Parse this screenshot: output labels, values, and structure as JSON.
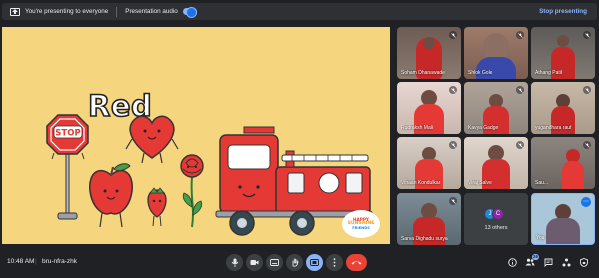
{
  "topbar": {
    "presenting_text": "You're presenting to everyone",
    "audio_label": "Presentation audio",
    "stop_label": "Stop presenting",
    "accent": "#8ab4f8"
  },
  "slide": {
    "title": "Red",
    "items": [
      "stop-sign",
      "apple",
      "heart",
      "strawberry",
      "rose",
      "fire-truck"
    ],
    "logo_text": [
      "HAPPY",
      "SUNSHINE",
      "FRIENDS"
    ],
    "background_color": "#f6d57f"
  },
  "participants": [
    {
      "name": "Soham Dhanawade",
      "muted": true
    },
    {
      "name": "Shlok Gole",
      "muted": true
    },
    {
      "name": "Athang Patil",
      "muted": true
    },
    {
      "name": "Rudraksh Mali",
      "muted": true
    },
    {
      "name": "Kavya Gadge",
      "muted": true
    },
    {
      "name": "yugandhara raut",
      "muted": true
    },
    {
      "name": "Vihaan Kondulkar",
      "muted": true
    },
    {
      "name": "Viraj Salve",
      "muted": true
    },
    {
      "name": "Sau...",
      "muted": true
    },
    {
      "name": "Sarva Dighadu surya",
      "muted": true
    }
  ],
  "others": {
    "label": "13 others",
    "avatars": [
      "J",
      "C"
    ]
  },
  "self": {
    "name": "You"
  },
  "bottombar": {
    "time": "10:48 AM",
    "separator": "|",
    "meeting_code": "bru-nfra-zhk",
    "people_badge": "26",
    "end_call_color": "#ea4335"
  }
}
